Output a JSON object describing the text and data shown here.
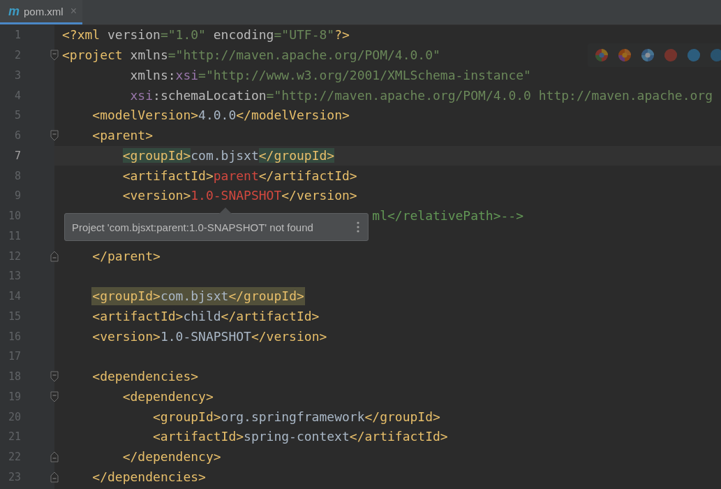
{
  "tabs": [
    {
      "icon": "m",
      "label": "pom.xml",
      "close": "×",
      "selected": true
    }
  ],
  "lines": [
    {
      "n": "1",
      "kind": "code",
      "current": false,
      "highlighted": false,
      "tokens": [
        {
          "kind": "tag",
          "t": "<?xml"
        },
        {
          "kind": "attr",
          "t": " version"
        },
        {
          "kind": "string",
          "t": "=\"1.0\""
        },
        {
          "kind": "attr",
          "t": " encoding"
        },
        {
          "kind": "string",
          "t": "=\"UTF-8\""
        },
        {
          "kind": "tag",
          "t": "?>"
        }
      ]
    },
    {
      "n": "2",
      "kind": "code",
      "current": false,
      "highlighted": false,
      "tokens": [
        {
          "kind": "tag",
          "t": "<project"
        },
        {
          "kind": "attr",
          "t": " xmlns"
        },
        {
          "kind": "string",
          "t": "=\"http://maven.apache.org/POM/4.0.0\""
        }
      ],
      "children": [
        {
          "n": "3",
          "kind": "continuation",
          "current": false,
          "highlighted": false,
          "tokens": [
            {
              "kind": "attr",
              "t": "xmlns:"
            },
            {
              "kind": "ns",
              "t": "xsi"
            },
            {
              "kind": "string",
              "t": "=\"http://www.w3.org/2001/XMLSchema-instance\""
            }
          ]
        },
        {
          "n": "4",
          "kind": "continuation",
          "current": false,
          "highlighted": false,
          "tokens": [
            {
              "kind": "ns",
              "t": "xsi"
            },
            {
              "kind": "attr",
              "t": ":schemaLocation"
            },
            {
              "kind": "string",
              "t": "=\"http://maven.apache.org/POM/4.0.0 http://maven.apache.org"
            }
          ]
        },
        {
          "n": "5",
          "kind": "code",
          "current": false,
          "highlighted": false,
          "tokens": [
            {
              "kind": "tag",
              "t": "<modelVersion>"
            },
            {
              "kind": "text",
              "t": "4.0.0"
            },
            {
              "kind": "tag",
              "t": "</modelVersion>"
            }
          ]
        },
        {
          "n": "6",
          "kind": "code",
          "current": false,
          "highlighted": false,
          "tokens": [
            {
              "kind": "tag",
              "t": "<parent>"
            }
          ],
          "children": [
            {
              "n": "7",
              "kind": "code",
              "current": true,
              "highlighted": false,
              "tokens": [
                {
                  "kind": "match",
                  "t": "<groupId>"
                },
                {
                  "kind": "text",
                  "t": "com.bjsxt"
                },
                {
                  "kind": "match",
                  "t": "</groupId>"
                }
              ]
            },
            {
              "n": "8",
              "kind": "code",
              "current": false,
              "highlighted": false,
              "tokens": [
                {
                  "kind": "tag",
                  "t": "<artifactId>"
                },
                {
                  "kind": "error",
                  "t": "parent"
                },
                {
                  "kind": "tag",
                  "t": "</artifactId>"
                }
              ]
            },
            {
              "n": "9",
              "kind": "code",
              "current": false,
              "highlighted": false,
              "tokens": [
                {
                  "kind": "tag",
                  "t": "<version>"
                },
                {
                  "kind": "error",
                  "t": "1.0-SNAPSHOT"
                },
                {
                  "kind": "tag",
                  "t": "</version>"
                }
              ]
            },
            {
              "n": "10",
              "kind": "covered",
              "current": false,
              "highlighted": false,
              "tokens": [
                {
                  "kind": "comment",
                  "t": "ml</relativePath>-->"
                }
              ]
            },
            {
              "n": "11",
              "kind": "blank",
              "current": false
            }
          ]
        },
        {
          "n": "12",
          "kind": "closing",
          "current": false,
          "highlighted": false,
          "tokens": [
            {
              "kind": "tag",
              "t": "</parent>"
            }
          ]
        },
        {
          "n": "13",
          "kind": "blank",
          "current": false
        },
        {
          "n": "14",
          "kind": "code",
          "current": false,
          "highlighted": true,
          "tokens": [
            {
              "kind": "tag",
              "t": "<groupId>"
            },
            {
              "kind": "text",
              "t": "com.bjsxt"
            },
            {
              "kind": "tag",
              "t": "</groupId>"
            }
          ]
        },
        {
          "n": "15",
          "kind": "code",
          "current": false,
          "highlighted": false,
          "tokens": [
            {
              "kind": "tag",
              "t": "<artifactId>"
            },
            {
              "kind": "text",
              "t": "child"
            },
            {
              "kind": "tag",
              "t": "</artifactId>"
            }
          ]
        },
        {
          "n": "16",
          "kind": "code",
          "current": false,
          "highlighted": false,
          "tokens": [
            {
              "kind": "tag",
              "t": "<version>"
            },
            {
              "kind": "text",
              "t": "1.0-SNAPSHOT"
            },
            {
              "kind": "tag",
              "t": "</version>"
            }
          ]
        },
        {
          "n": "17",
          "kind": "blank",
          "current": false
        },
        {
          "n": "18",
          "kind": "code",
          "current": false,
          "highlighted": false,
          "tokens": [
            {
              "kind": "tag",
              "t": "<dependencies>"
            }
          ],
          "children": [
            {
              "n": "19",
              "kind": "code",
              "current": false,
              "highlighted": false,
              "tokens": [
                {
                  "kind": "tag",
                  "t": "<dependency>"
                }
              ],
              "children": [
                {
                  "n": "20",
                  "kind": "code",
                  "current": false,
                  "highlighted": false,
                  "tokens": [
                    {
                      "kind": "tag",
                      "t": "<groupId>"
                    },
                    {
                      "kind": "text",
                      "t": "org.springframework"
                    },
                    {
                      "kind": "tag",
                      "t": "</groupId>"
                    }
                  ]
                },
                {
                  "n": "21",
                  "kind": "code",
                  "current": false,
                  "highlighted": false,
                  "tokens": [
                    {
                      "kind": "tag",
                      "t": "<artifactId>"
                    },
                    {
                      "kind": "text",
                      "t": "spring-context"
                    },
                    {
                      "kind": "tag",
                      "t": "</artifactId>"
                    }
                  ]
                }
              ]
            },
            {
              "n": "22",
              "kind": "closing",
              "current": false,
              "highlighted": false,
              "tokens": [
                {
                  "kind": "tag",
                  "t": "</dependency>"
                }
              ]
            }
          ]
        },
        {
          "n": "23",
          "kind": "closing",
          "current": false,
          "highlighted": false,
          "tokens": [
            {
              "kind": "tag",
              "t": "</dependencies>"
            }
          ]
        }
      ]
    }
  ],
  "tooltip": {
    "message": "Project 'com.bjsxt:parent:1.0-SNAPSHOT' not found"
  }
}
